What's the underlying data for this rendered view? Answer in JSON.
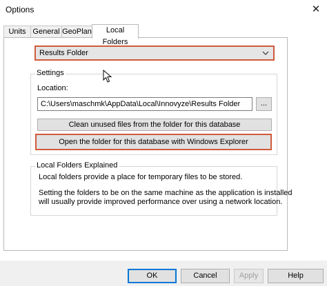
{
  "window": {
    "title": "Options",
    "close_glyph": "✕"
  },
  "tabs": [
    {
      "label": "Units"
    },
    {
      "label": "General"
    },
    {
      "label": "GeoPlan"
    },
    {
      "label": "Local Folders"
    }
  ],
  "active_tab": "Local Folders",
  "folder_select": {
    "value": "Results Folder"
  },
  "settings": {
    "group_label": "Settings",
    "location_label": "Location:",
    "location_value": "C:\\Users\\maschmk\\AppData\\Local\\Innovyze\\Results Folder",
    "browse_label": "...",
    "clean_label": "Clean unused files from the folder for this database",
    "open_label": "Open the folder for this database with Windows Explorer"
  },
  "explained": {
    "group_label": "Local Folders Explained",
    "para1": "Local folders provide a place for temporary files to be stored.",
    "para2_line1": "Setting the folders to be on the same machine as the application is installed",
    "para2_line2": "will usually provide improved performance over using a network location."
  },
  "footer": {
    "ok": "OK",
    "cancel": "Cancel",
    "apply": "Apply",
    "help": "Help"
  },
  "colors": {
    "highlight": "#d05a3a",
    "default_button": "#0078d7"
  },
  "icons": {
    "dropdown": "chevron-down-icon",
    "cursor": "mouse-pointer-icon",
    "close": "close-icon"
  }
}
